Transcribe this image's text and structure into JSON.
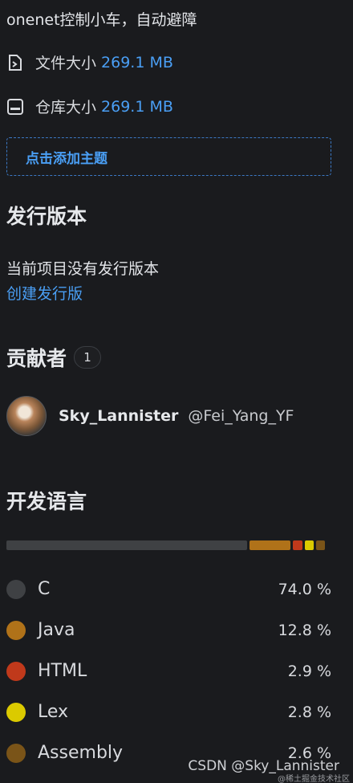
{
  "repo": {
    "description": "onenet控制小车，自动避障",
    "file_size_label": "文件大小",
    "file_size_value": "269.1 MB",
    "repo_size_label": "仓库大小",
    "repo_size_value": "269.1 MB",
    "add_topic_label": "点击添加主题"
  },
  "releases": {
    "title": "发行版本",
    "empty_text": "当前项目没有发行版本",
    "create_link": "创建发行版"
  },
  "contributors": {
    "title": "贡献者",
    "count": "1",
    "items": [
      {
        "name": "Sky_Lannister",
        "handle": "@Fei_Yang_YF"
      }
    ]
  },
  "languages": {
    "title": "开发语言",
    "items": [
      {
        "name": "C",
        "percent_label": "74.0 %",
        "percent": 74.0,
        "color": "#3f4144"
      },
      {
        "name": "Java",
        "percent_label": "12.8 %",
        "percent": 12.8,
        "color": "#b07219"
      },
      {
        "name": "HTML",
        "percent_label": "2.9 %",
        "percent": 2.9,
        "color": "#c0391b"
      },
      {
        "name": "Lex",
        "percent_label": "2.8 %",
        "percent": 2.8,
        "color": "#dbca00"
      },
      {
        "name": "Assembly",
        "percent_label": "2.6 %",
        "percent": 2.6,
        "color": "#7a5418"
      }
    ]
  },
  "watermark": {
    "main": "CSDN @Sky_Lannister",
    "sub": "@稀土掘金技术社区"
  }
}
